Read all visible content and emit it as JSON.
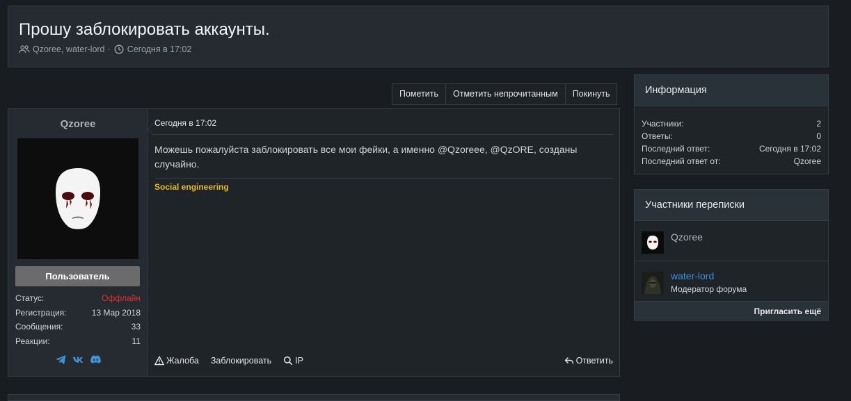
{
  "thread": {
    "title": "Прошу заблокировать аккаунты.",
    "participants": "Qzoree, water-lord",
    "separator": "·",
    "date": "Сегодня в 17:02"
  },
  "actions": {
    "mark": "Пометить",
    "mark_unread": "Отметить непрочитанным",
    "leave": "Покинуть"
  },
  "post": {
    "author": "Qzoree",
    "role": "Пользователь",
    "stats": [
      {
        "label": "Статус:",
        "value": "Оффлайн"
      },
      {
        "label": "Регистрация:",
        "value": "13 Мар 2018"
      },
      {
        "label": "Сообщения:",
        "value": "33"
      },
      {
        "label": "Реакции:",
        "value": "11"
      }
    ],
    "socials": [
      "telegram-icon",
      "vk-icon",
      "discord-icon"
    ],
    "date": "Сегодня в 17:02",
    "text": "Можешь пожалуйста заблокировать все мои фейки, а именно @Qzoreee, @QzORE, созданы случайно.",
    "prefix": "Social engineering",
    "footer": {
      "report": "Жалоба",
      "block": "Заблокировать",
      "ip": "IP",
      "reply": "Ответить"
    }
  },
  "sidebar": {
    "info": {
      "title": "Информация",
      "rows": [
        {
          "label": "Участники:",
          "value": "2"
        },
        {
          "label": "Ответы:",
          "value": "0"
        },
        {
          "label": "Последний ответ:",
          "value": "Сегодня в 17:02"
        },
        {
          "label": "Последний ответ от:",
          "value": "Qzoree"
        }
      ]
    },
    "participants": {
      "title": "Участники переписки",
      "items": [
        {
          "name": "Qzoree",
          "role": ""
        },
        {
          "name": "water-lord",
          "role": "Модератор форума"
        }
      ],
      "invite": "Пригласить ещё"
    }
  },
  "colors": {
    "accent_link": "#3f8fd8",
    "offline": "#e12d2d",
    "prefix": "#e8b923"
  }
}
